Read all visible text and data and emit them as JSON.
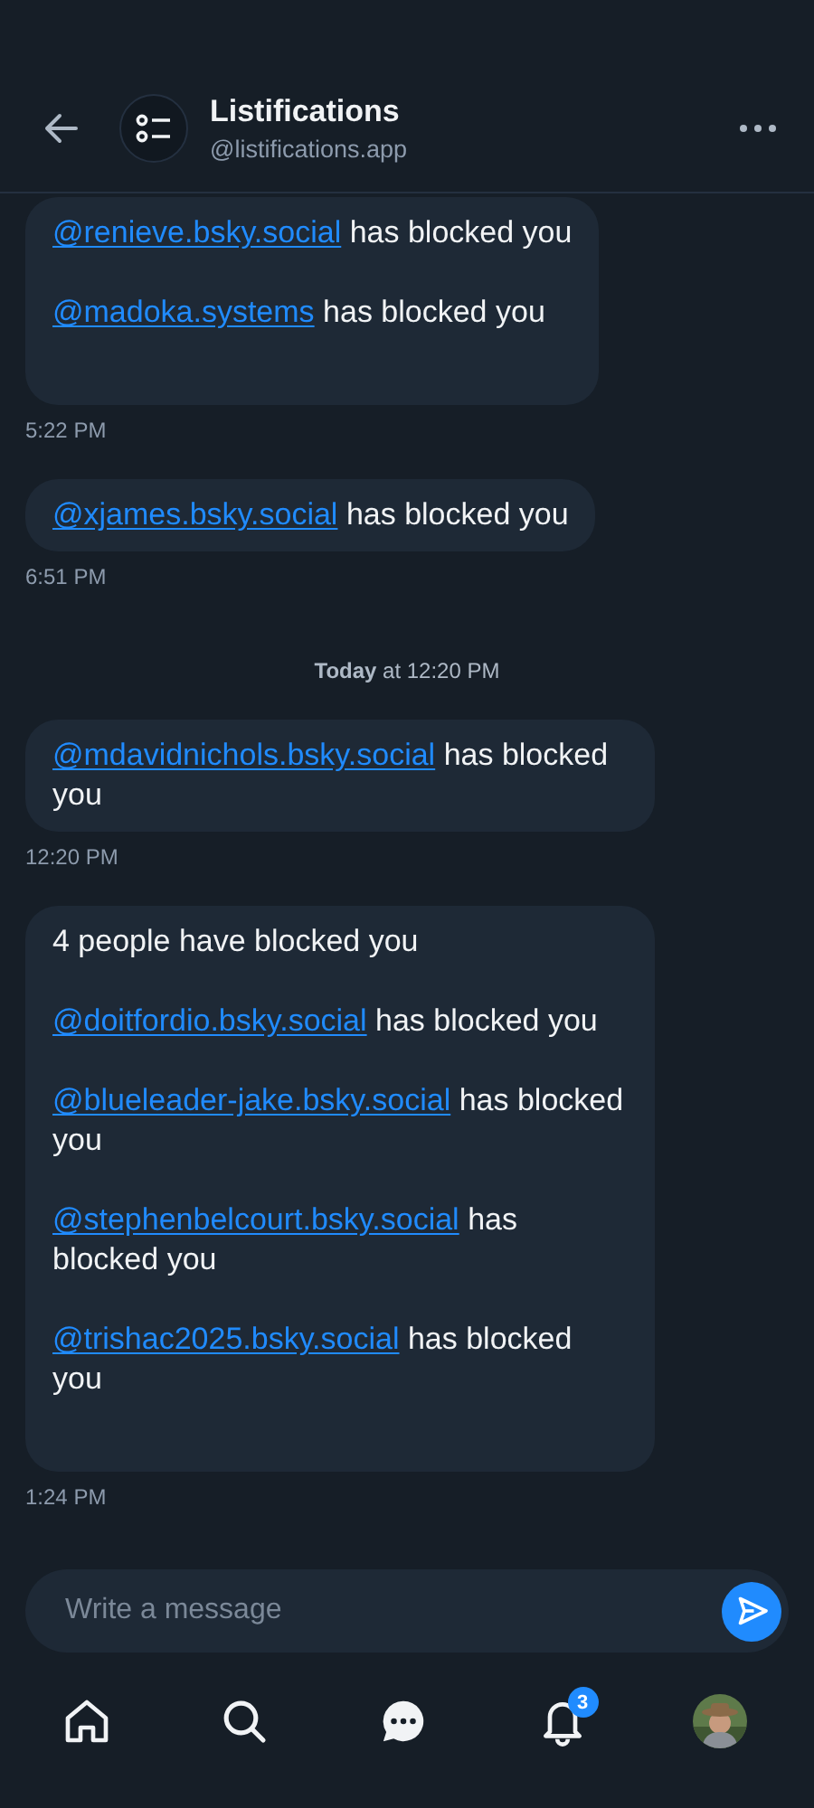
{
  "header": {
    "title": "Listifications",
    "handle": "@listifications.app"
  },
  "messages": [
    {
      "kind": "message",
      "paragraphs": [
        {
          "handle": "@renieve.bsky.social",
          "text": " has blocked you"
        },
        {
          "handle": "@madoka.systems",
          "text": " has blocked you"
        }
      ],
      "time": "5:22 PM"
    },
    {
      "kind": "message",
      "paragraphs": [
        {
          "handle": "@xjames.bsky.social",
          "text": " has blocked you"
        }
      ],
      "time": "6:51 PM"
    },
    {
      "kind": "separator",
      "text": "**Today** at 12:20 PM"
    },
    {
      "kind": "message",
      "paragraphs": [
        {
          "handle": "@mdavidnichols.bsky.social",
          "text": " has blocked you"
        }
      ],
      "time": "12:20 PM"
    },
    {
      "kind": "message",
      "paragraphs": [
        {
          "text": "4 people have blocked you"
        },
        {
          "handle": "@doitfordio.bsky.social",
          "text": " has blocked you"
        },
        {
          "handle": "@blueleader-jake.bsky.social",
          "text": " has blocked you"
        },
        {
          "handle": "@stephenbelcourt.bsky.social",
          "text": " has blocked you"
        },
        {
          "handle": "@trishac2025.bsky.social",
          "text": " has blocked you"
        }
      ],
      "time": "1:24 PM"
    }
  ],
  "composer": {
    "placeholder": "Write a message"
  },
  "nav": [
    {
      "kind": "home"
    },
    {
      "kind": "search"
    },
    {
      "kind": "chat"
    },
    {
      "kind": "bell",
      "badge": "3"
    },
    {
      "kind": "avatar"
    }
  ]
}
